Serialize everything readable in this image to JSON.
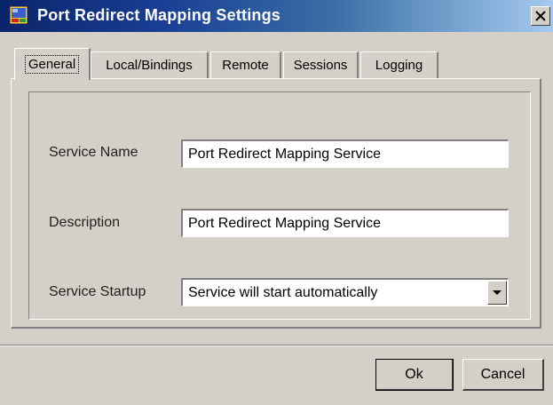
{
  "window": {
    "title": "Port Redirect Mapping Settings",
    "app_icon": "app-window-icon",
    "close_icon": "close-icon"
  },
  "tabs": [
    {
      "label": "General",
      "active": true
    },
    {
      "label": "Local/Bindings",
      "active": false
    },
    {
      "label": "Remote",
      "active": false
    },
    {
      "label": "Sessions",
      "active": false
    },
    {
      "label": "Logging",
      "active": false
    }
  ],
  "form": {
    "service_name": {
      "label": "Service Name",
      "value": "Port Redirect Mapping Service"
    },
    "description": {
      "label": "Description",
      "value": "Port Redirect Mapping Service"
    },
    "service_startup": {
      "label": "Service Startup",
      "value": "Service will start automatically",
      "icon": "chevron-down-icon"
    }
  },
  "buttons": {
    "ok": "Ok",
    "cancel": "Cancel"
  },
  "colors": {
    "title_bar_start": "#0a246a",
    "title_bar_end": "#a6caf0",
    "dialog_face": "#d4d0c8"
  }
}
